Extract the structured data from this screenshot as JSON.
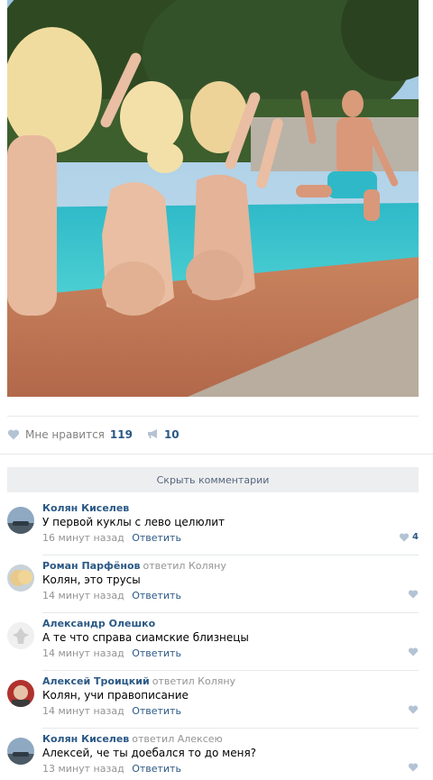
{
  "post": {
    "photo_alt": "Фото",
    "likes_label": "Мне нравится",
    "likes_count": "119",
    "reposts_count": "10"
  },
  "hide_comments_label": "Скрыть комментарии",
  "comments": [
    {
      "author": "Колян Киселев",
      "replied": "",
      "text": "У первой куклы с лево целюлит",
      "time": "16 минут назад",
      "reply_label": "Ответить",
      "likes": "4"
    },
    {
      "author": "Роман Парфёнов",
      "replied": "ответил Коляну",
      "text": "Колян, это трусы",
      "time": "14 минут назад",
      "reply_label": "Ответить",
      "likes": ""
    },
    {
      "author": "Александр Олешко",
      "replied": "",
      "text": "А те что справа сиамские близнецы",
      "time": "14 минут назад",
      "reply_label": "Ответить",
      "likes": ""
    },
    {
      "author": "Алексей Троицкий",
      "replied": "ответил Коляну",
      "text": "Колян, учи правописание",
      "time": "14 минут назад",
      "reply_label": "Ответить",
      "likes": ""
    },
    {
      "author": "Колян Киселев",
      "replied": "ответил Алексею",
      "text": "Алексей, че ты доебался то до меня?",
      "time": "13 минут назад",
      "reply_label": "Ответить",
      "likes": ""
    }
  ],
  "colors": {
    "link": "#2a5885",
    "muted": "#939393",
    "divider": "#e7e8ec",
    "button_bg": "#edeef0"
  },
  "icons": {
    "like": "heart-icon",
    "repost": "megaphone-icon"
  }
}
